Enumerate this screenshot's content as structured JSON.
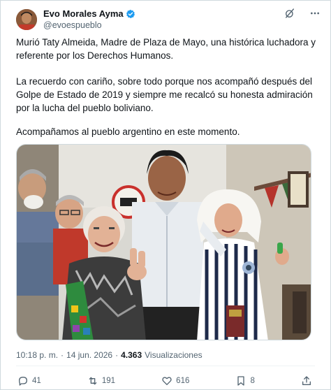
{
  "author": {
    "name": "Evo Morales Ayma",
    "handle": "@evoespueblo",
    "verified": true,
    "verified_color": "#1d9bf0"
  },
  "post": {
    "paragraph_1": "Murió Taty Almeida, Madre de Plaza de Mayo, una histórica luchadora y referente por los Derechos Humanos.",
    "paragraph_2": "La recuerdo con cariño, sobre todo porque nos acompañó después del Golpe de Estado de 2019 y siempre me recalcó su honesta admiración por la lucha del pueblo boliviano.",
    "paragraph_3": "Acompañamos al pueblo argentino en este momento."
  },
  "meta": {
    "time": "10:18 p. m.",
    "separator": "·",
    "date": "14 jun. 2026",
    "separator_2": "·",
    "views_count": "4.363",
    "views_label": "Visualizaciones"
  },
  "actions": {
    "replies": "41",
    "reposts": "191",
    "likes": "616",
    "bookmarks": "8"
  },
  "icons": {
    "top": [
      "grok-icon",
      "more-icon"
    ],
    "action_bar": [
      "reply-icon",
      "repost-icon",
      "like-icon",
      "bookmark-icon",
      "share-icon"
    ]
  },
  "colors": {
    "text_primary": "#0f1419",
    "text_secondary": "#536471",
    "border": "#cfd9de"
  }
}
